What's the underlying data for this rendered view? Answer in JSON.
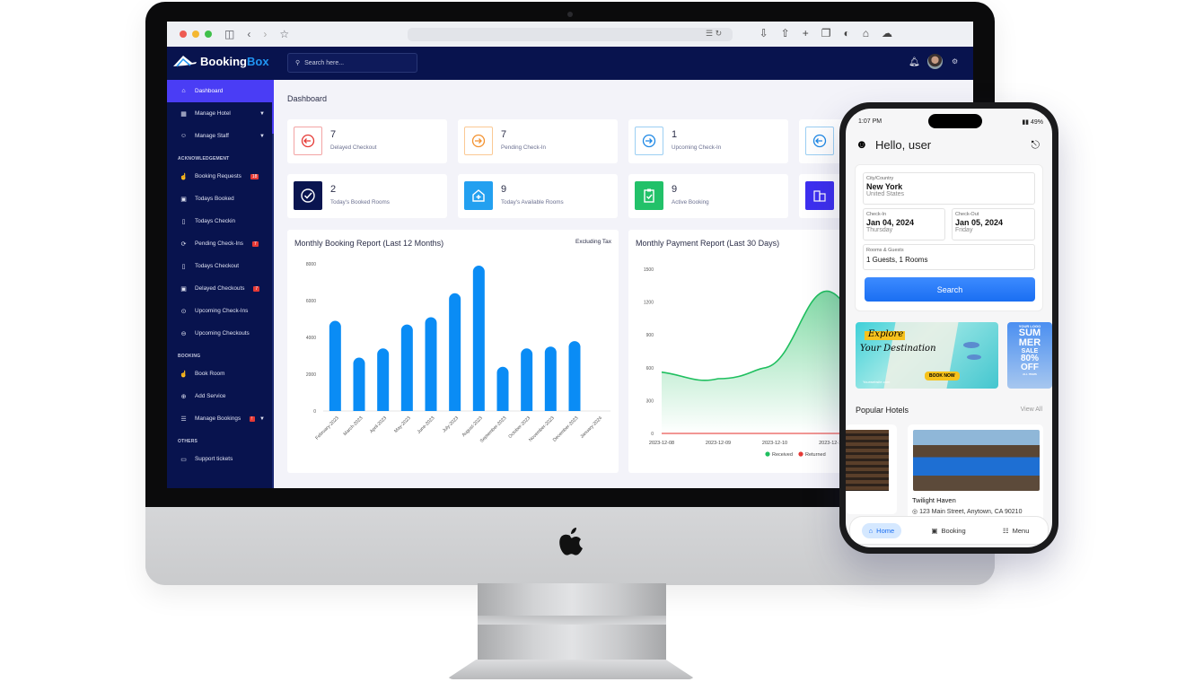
{
  "browser": {
    "traffic_lights": {
      "close": "#ee5b52",
      "minimize": "#f4b731",
      "maximize": "#3fc04a"
    },
    "icons": [
      "sidebar-toggle-icon",
      "back-icon",
      "forward-icon",
      "bookmark-star-icon",
      "translate-icon",
      "reload-icon",
      "download-icon",
      "share-icon",
      "new-tab-icon",
      "tabs-icon",
      "privacy-icon",
      "home-icon",
      "cloud-icon"
    ]
  },
  "app": {
    "logo_primary": "Booking",
    "logo_accent": "Box",
    "search_placeholder": "Search here...",
    "colors": {
      "nav_bg": "#08134e",
      "active": "#4a3df5",
      "accent": "#2196f3",
      "bar": "#0a8cf5",
      "received": "#1fbf5f",
      "returned": "#e53935"
    }
  },
  "sidebar": {
    "items": [
      {
        "label": "Dashboard",
        "icon": "home-icon",
        "active": true
      },
      {
        "label": "Manage Hotel",
        "icon": "building-icon",
        "chevron": true
      },
      {
        "label": "Manage Staff",
        "icon": "staff-icon",
        "chevron": true
      }
    ],
    "sections": [
      {
        "title": "ACKNOWLEDGEMENT",
        "items": [
          {
            "label": "Booking Requests",
            "icon": "thumb-icon",
            "badge": "18"
          },
          {
            "label": "Todays Booked",
            "icon": "calendar-icon"
          },
          {
            "label": "Todays Checkin",
            "icon": "door-icon"
          },
          {
            "label": "Pending Check-Ins",
            "icon": "spinner-icon",
            "badge": "7"
          },
          {
            "label": "Todays Checkout",
            "icon": "door-out-icon"
          },
          {
            "label": "Delayed Checkouts",
            "icon": "calendar-x-icon",
            "badge": "7"
          },
          {
            "label": "Upcoming Check-Ins",
            "icon": "enter-icon"
          },
          {
            "label": "Upcoming Checkouts",
            "icon": "exit-icon"
          }
        ]
      },
      {
        "title": "BOOKING",
        "items": [
          {
            "label": "Book Room",
            "icon": "thumb-icon"
          },
          {
            "label": "Add Service",
            "icon": "plus-circle-icon"
          },
          {
            "label": "Manage Bookings",
            "icon": "list-icon",
            "badge": "!",
            "chevron": true
          }
        ]
      },
      {
        "title": "OTHERS",
        "items": [
          {
            "label": "Support tickets",
            "icon": "ticket-icon"
          }
        ]
      }
    ]
  },
  "main": {
    "title": "Dashboard",
    "cards": [
      {
        "value": "7",
        "label": "Delayed Checkout",
        "icon": "exit-icon",
        "style": "outline-red"
      },
      {
        "value": "7",
        "label": "Pending Check-In",
        "icon": "enter-icon",
        "style": "outline-orange"
      },
      {
        "value": "1",
        "label": "Upcoming Check-In",
        "icon": "enter-icon",
        "style": "outline-blue"
      },
      {
        "value": "",
        "label": "",
        "icon": "exit-icon",
        "style": "outline-blue"
      },
      {
        "value": "2",
        "label": "Today's Booked Rooms",
        "icon": "check-circle-icon",
        "style": "solid-navy"
      },
      {
        "value": "9",
        "label": "Today's Available Rooms",
        "icon": "hospital-icon",
        "style": "solid-sky"
      },
      {
        "value": "9",
        "label": "Active Booking",
        "icon": "clipboard-check-icon",
        "style": "solid-green"
      },
      {
        "value": "",
        "label": "",
        "icon": "buildings-icon",
        "style": "solid-indigo"
      }
    ]
  },
  "chart_data": [
    {
      "type": "bar",
      "title": "Monthly Booking Report (Last 12 Months)",
      "note": "Excluding Tax",
      "categories": [
        "February-2023",
        "March-2023",
        "April-2023",
        "May-2023",
        "June-2023",
        "July-2023",
        "August-2023",
        "September-2023",
        "October-2023",
        "November-2023",
        "December-2023",
        "January-2024"
      ],
      "values": [
        4900,
        2900,
        3400,
        4700,
        5100,
        6400,
        7900,
        2400,
        3400,
        3500,
        3800,
        null
      ],
      "yticks": [
        "0",
        "2000",
        "4000",
        "6000",
        "8000"
      ],
      "ylim": [
        0,
        8000
      ],
      "xlabel": "",
      "ylabel": ""
    },
    {
      "type": "area",
      "title": "Monthly Payment Report (Last 30 Days)",
      "x": [
        "2023-12-08",
        "2023-12-09",
        "2023-12-10",
        "2023-12-11"
      ],
      "series": [
        {
          "name": "Received",
          "values": [
            560,
            500,
            650,
            1300
          ]
        },
        {
          "name": "Returned",
          "values": [
            0,
            0,
            0,
            0
          ]
        }
      ],
      "yticks": [
        "0",
        "300",
        "600",
        "900",
        "1200",
        "1500"
      ],
      "ylim": [
        0,
        1500
      ],
      "legend": "bottom"
    }
  ],
  "phone": {
    "time": "1:07 PM",
    "battery": "49",
    "greeting": "Hello, user",
    "location": {
      "label": "City/Country",
      "value": "New York",
      "sub": "United States"
    },
    "checkin": {
      "label": "Check-In",
      "value": "Jan 04, 2024",
      "sub": "Thursday"
    },
    "checkout": {
      "label": "Check-Out",
      "value": "Jan 05, 2024",
      "sub": "Friday"
    },
    "rooms": {
      "label": "Rooms & Guests",
      "value": "1 Guests, 1 Rooms"
    },
    "search_label": "Search",
    "banner1": {
      "line1": "Explore",
      "line2": "Your Destination",
      "cta": "BOOK NOW",
      "site": "Yourwebsite.com"
    },
    "banner2": {
      "logo": "YOUR LOGO",
      "l1": "SUM",
      "l2": "MER",
      "l3": "SALE",
      "l4": "80%",
      "l5": "OFF",
      "l6": "ALL ITEMS"
    },
    "popular_title": "Popular Hotels",
    "view_all": "View All",
    "hotel": {
      "name": "Twilight Haven",
      "address": "123 Main Street, Anytown, CA 90210"
    },
    "tabs": [
      {
        "label": "Home",
        "active": true
      },
      {
        "label": "Booking"
      },
      {
        "label": "Menu"
      }
    ]
  }
}
